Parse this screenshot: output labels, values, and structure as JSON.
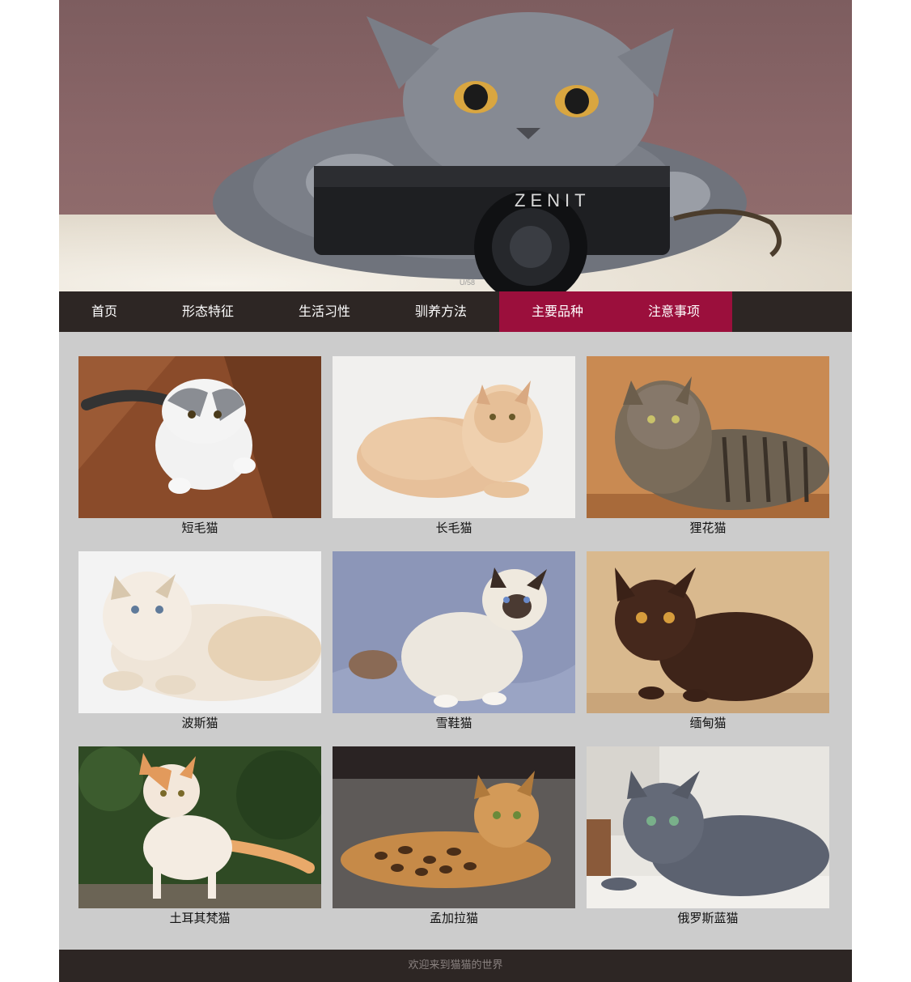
{
  "banner": {
    "camera_brand": "ZENIT",
    "lens_text": "U/58"
  },
  "nav": {
    "items": [
      {
        "label": "首页"
      },
      {
        "label": "形态特征"
      },
      {
        "label": "生活习性"
      },
      {
        "label": "驯养方法"
      },
      {
        "label": "主要品种"
      },
      {
        "label": "注意事项"
      }
    ],
    "active_index": 4
  },
  "breeds": [
    {
      "name": "短毛猫"
    },
    {
      "name": "长毛猫"
    },
    {
      "name": "狸花猫"
    },
    {
      "name": "波斯猫"
    },
    {
      "name": "雪鞋猫"
    },
    {
      "name": "缅甸猫"
    },
    {
      "name": "土耳其梵猫"
    },
    {
      "name": "孟加拉猫"
    },
    {
      "name": "俄罗斯蓝猫"
    }
  ],
  "footer": {
    "text": "欢迎来到猫猫的世界"
  },
  "colors": {
    "nav_bg": "#2d2624",
    "nav_active": "#9b0f3c",
    "content_bg": "#cccccc",
    "footer_text": "#8a8280"
  }
}
